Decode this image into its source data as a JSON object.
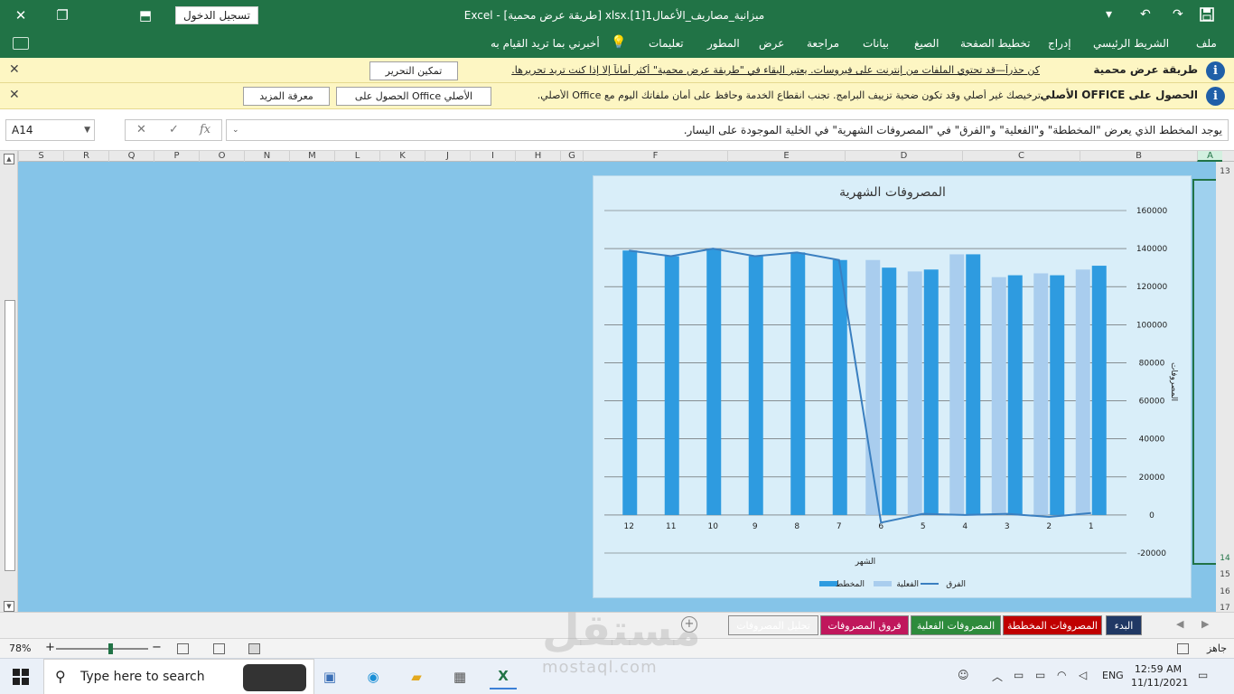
{
  "window": {
    "title": "ميزانية_مصاريف_الأعمال1[1].xlsx  [طريقة عرض محمية]  -  Excel",
    "sign_in": "تسجيل الدخول"
  },
  "ribbon": {
    "tabs": [
      "ملف",
      "الشريط الرئيسي",
      "إدراج",
      "تخطيط الصفحة",
      "الصيغ",
      "بيانات",
      "مراجعة",
      "عرض",
      "المطور",
      "تعليمات"
    ],
    "tell_me": "أخبرني بما تريد القيام به"
  },
  "protected_bar": {
    "title": "طريقة عرض محمية",
    "text": "كن حذراً—قد تحتوي الملفات من إنترنت على فيروسات. يعتبر البقاء في \"طريقة عرض محمية\" أكثر أماناً إلا إذا كنت تريد تحريرها.",
    "button": "تمكين التحرير"
  },
  "genuine_bar": {
    "title": "الحصول على OFFICE الأصلي",
    "text": "ترخيصك غير أصلي وقد تكون ضحية تزييف البرامج. تجنب انقطاع الخدمة وحافظ على أمان ملفاتك اليوم مع Office الأصلي.",
    "button_get": "الحصول على Office الأصلي",
    "button_learn": "معرفة المزيد"
  },
  "formula_bar": {
    "name_box": "A14",
    "fx": "fx",
    "formula": "يوجد المخطط الذي يعرض \"المخططة\" و\"الفعلية\" و\"الفرق\" في \"المصروفات الشهرية\" في الخلية الموجودة على اليسار."
  },
  "columns": [
    {
      "label": "S",
      "w": 50
    },
    {
      "label": "R",
      "w": 50
    },
    {
      "label": "Q",
      "w": 50
    },
    {
      "label": "P",
      "w": 50
    },
    {
      "label": "O",
      "w": 50
    },
    {
      "label": "N",
      "w": 50
    },
    {
      "label": "M",
      "w": 50
    },
    {
      "label": "L",
      "w": 50
    },
    {
      "label": "K",
      "w": 50
    },
    {
      "label": "J",
      "w": 50
    },
    {
      "label": "I",
      "w": 50
    },
    {
      "label": "H",
      "w": 50
    },
    {
      "label": "G",
      "w": 25
    },
    {
      "label": "F",
      "w": 160
    },
    {
      "label": "E",
      "w": 130
    },
    {
      "label": "D",
      "w": 130
    },
    {
      "label": "C",
      "w": 130
    },
    {
      "label": "B",
      "w": 130
    },
    {
      "label": "A",
      "w": 28
    }
  ],
  "rows": [
    "13",
    "14",
    "15",
    "16",
    "17"
  ],
  "chart_data": {
    "type": "bar",
    "title": "المصروفات الشهرية",
    "xlabel": "الشهر",
    "ylabel": "المصروفات",
    "ylim": [
      -20000,
      160000
    ],
    "yticks": [
      "-20000",
      "0",
      "20000",
      "40000",
      "60000",
      "80000",
      "100000",
      "120000",
      "140000",
      "160000"
    ],
    "categories": [
      "1",
      "2",
      "3",
      "4",
      "5",
      "6",
      "7",
      "8",
      "9",
      "10",
      "11",
      "12"
    ],
    "grid": true,
    "legend": "bottom",
    "series": [
      {
        "name": "المخطط",
        "kind": "bar",
        "color": "#2e9be0",
        "values": [
          131000,
          126000,
          126000,
          137000,
          129000,
          130000,
          134000,
          138000,
          136000,
          140000,
          136000,
          139000
        ]
      },
      {
        "name": "الفعلية",
        "kind": "bar",
        "color": "#a9cdee",
        "values": [
          129000,
          127000,
          125000,
          137000,
          128000,
          134000,
          0,
          0,
          0,
          0,
          0,
          0
        ]
      },
      {
        "name": "الفرق",
        "kind": "line",
        "color": "#3a7fc0",
        "values": [
          1000,
          -1000,
          600,
          0,
          600,
          -4000,
          134000,
          138000,
          136000,
          140000,
          136000,
          139000
        ]
      }
    ]
  },
  "sheet_tabs": [
    {
      "label": "البدء",
      "color": "#203864"
    },
    {
      "label": "المصروفات المخططة",
      "color": "#c00000"
    },
    {
      "label": "المصروفات الفعلية",
      "color": "#2e8b3c"
    },
    {
      "label": "فروق المصروفات",
      "color": "#c0175c"
    },
    {
      "label": "تحليل المصروفات",
      "color": "#ffffff",
      "active": true
    }
  ],
  "status": {
    "ready": "جاهز",
    "zoom": "78%"
  },
  "taskbar": {
    "search_placeholder": "Type here to search",
    "lang": "ENG",
    "time": "12:59 AM",
    "date": "11/11/2021"
  },
  "watermark": {
    "arabic": "مستقل",
    "latin": "mostaql.com"
  }
}
